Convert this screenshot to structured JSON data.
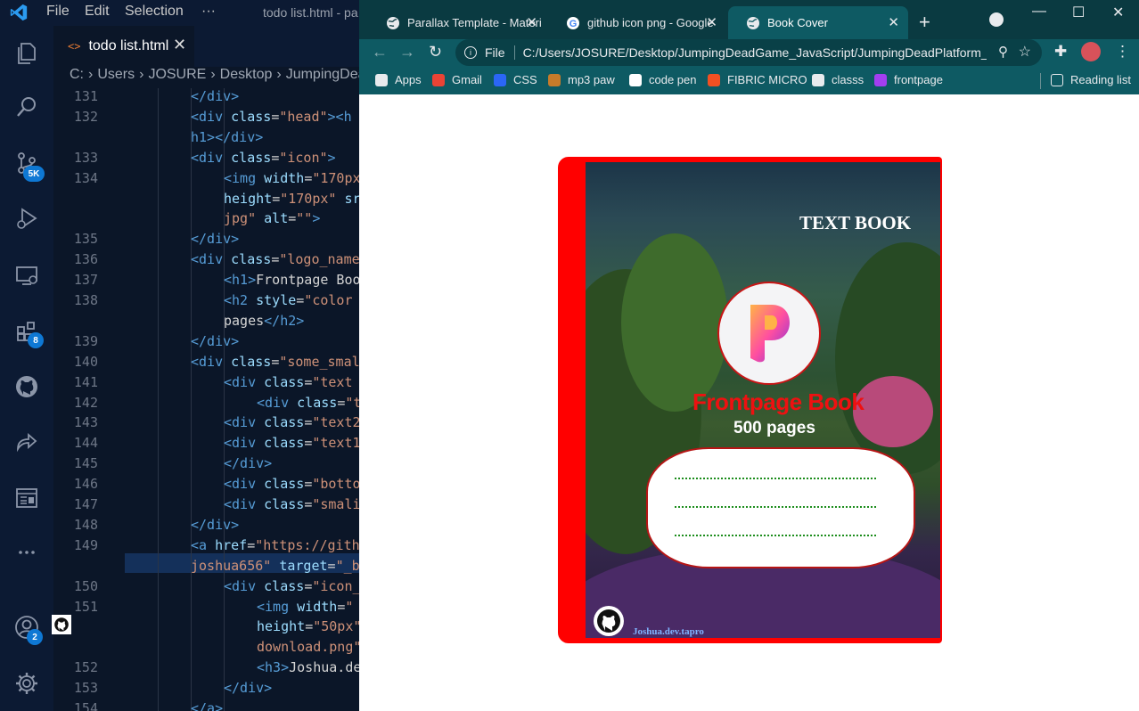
{
  "vscode": {
    "menu": [
      "File",
      "Edit",
      "Selection",
      "···"
    ],
    "window_title": "todo list.html - pa",
    "activity_badges": {
      "source_control": "5K",
      "extensions": "8",
      "accounts": "2"
    },
    "tab": {
      "icon": "<>",
      "label": "todo list.html",
      "close": "✕"
    },
    "breadcrumb": [
      "C:",
      "›",
      "Users",
      "›",
      "JOSURE",
      "›",
      "Desktop",
      "›",
      "JumpingDeadG"
    ],
    "line_numbers": [
      "131",
      "132",
      "133",
      "134",
      "135",
      "136",
      "137",
      "138",
      "139",
      "140",
      "141",
      "142",
      "143",
      "144",
      "145",
      "146",
      "147",
      "148",
      "149",
      "150",
      "151",
      "152",
      "153",
      "154"
    ],
    "code": [
      {
        "indent": 0,
        "parts": [
          [
            "tg",
            "</div>"
          ]
        ]
      },
      {
        "indent": 0,
        "parts": [
          [
            "tg",
            "<div "
          ],
          [
            "at",
            "class"
          ],
          [
            "tx",
            "="
          ],
          [
            "st",
            "\"head\""
          ],
          [
            "tg",
            "><h"
          ]
        ]
      },
      {
        "indent": 0,
        "parts": [
          [
            "tg",
            "h1></div>"
          ]
        ]
      },
      {
        "indent": 0,
        "parts": [
          [
            "tg",
            "<div "
          ],
          [
            "at",
            "class"
          ],
          [
            "tx",
            "="
          ],
          [
            "st",
            "\"icon\""
          ],
          [
            "tg",
            ">"
          ]
        ]
      },
      {
        "indent": 1,
        "parts": [
          [
            "tg",
            "<img "
          ],
          [
            "at",
            "width"
          ],
          [
            "tx",
            "="
          ],
          [
            "st",
            "\"170px"
          ]
        ]
      },
      {
        "indent": 1,
        "parts": [
          [
            "at",
            "height"
          ],
          [
            "tx",
            "="
          ],
          [
            "st",
            "\"170px\" "
          ],
          [
            "at",
            "sr"
          ]
        ]
      },
      {
        "indent": 1,
        "parts": [
          [
            "st",
            "jpg\" "
          ],
          [
            "at",
            "alt"
          ],
          [
            "tx",
            "="
          ],
          [
            "st",
            "\"\""
          ],
          [
            "tg",
            ">"
          ]
        ]
      },
      {
        "indent": 0,
        "parts": [
          [
            "tg",
            "</div>"
          ]
        ]
      },
      {
        "indent": 0,
        "parts": [
          [
            "tg",
            "<div "
          ],
          [
            "at",
            "class"
          ],
          [
            "tx",
            "="
          ],
          [
            "st",
            "\"logo_name"
          ]
        ]
      },
      {
        "indent": 1,
        "parts": [
          [
            "tg",
            "<h1>"
          ],
          [
            "tx",
            "Frontpage Boo"
          ]
        ]
      },
      {
        "indent": 1,
        "parts": [
          [
            "tg",
            "<h2 "
          ],
          [
            "at",
            "style"
          ],
          [
            "tx",
            "="
          ],
          [
            "st",
            "\"color"
          ]
        ]
      },
      {
        "indent": 1,
        "parts": [
          [
            "tx",
            "pages"
          ],
          [
            "tg",
            "</h2>"
          ]
        ]
      },
      {
        "indent": 0,
        "parts": [
          [
            "tg",
            "</div>"
          ]
        ]
      },
      {
        "indent": 0,
        "parts": [
          [
            "tg",
            "<div "
          ],
          [
            "at",
            "class"
          ],
          [
            "tx",
            "="
          ],
          [
            "st",
            "\"some_smal"
          ]
        ]
      },
      {
        "indent": 1,
        "parts": [
          [
            "tg",
            "<div "
          ],
          [
            "at",
            "class"
          ],
          [
            "tx",
            "="
          ],
          [
            "st",
            "\"text"
          ]
        ]
      },
      {
        "indent": 2,
        "parts": [
          [
            "tg",
            "<div "
          ],
          [
            "at",
            "class"
          ],
          [
            "tx",
            "="
          ],
          [
            "st",
            "\"t"
          ]
        ]
      },
      {
        "indent": 1,
        "parts": [
          [
            "tg",
            "<div "
          ],
          [
            "at",
            "class"
          ],
          [
            "tx",
            "="
          ],
          [
            "st",
            "\"text2"
          ]
        ]
      },
      {
        "indent": 1,
        "parts": [
          [
            "tg",
            "<div "
          ],
          [
            "at",
            "class"
          ],
          [
            "tx",
            "="
          ],
          [
            "st",
            "\"text1"
          ]
        ]
      },
      {
        "indent": 1,
        "parts": [
          [
            "tg",
            "</div>"
          ]
        ]
      },
      {
        "indent": 1,
        "parts": [
          [
            "tg",
            "<div "
          ],
          [
            "at",
            "class"
          ],
          [
            "tx",
            "="
          ],
          [
            "st",
            "\"botto"
          ]
        ]
      },
      {
        "indent": 1,
        "parts": [
          [
            "tg",
            "<div "
          ],
          [
            "at",
            "class"
          ],
          [
            "tx",
            "="
          ],
          [
            "st",
            "\"smali"
          ]
        ]
      },
      {
        "indent": 0,
        "parts": [
          [
            "tg",
            "</div>"
          ]
        ]
      },
      {
        "indent": 0,
        "parts": [
          [
            "tg",
            "<a "
          ],
          [
            "at",
            "href"
          ],
          [
            "tx",
            "="
          ],
          [
            "st",
            "\"https://gith"
          ]
        ]
      },
      {
        "indent": 0,
        "parts": [
          [
            "st",
            "joshua656\" "
          ],
          [
            "at",
            "target"
          ],
          [
            "tx",
            "="
          ],
          [
            "st",
            "\"_b"
          ]
        ]
      },
      {
        "indent": 1,
        "parts": [
          [
            "tg",
            "<div "
          ],
          [
            "at",
            "class"
          ],
          [
            "tx",
            "="
          ],
          [
            "st",
            "\"icon_"
          ]
        ]
      },
      {
        "indent": 2,
        "parts": [
          [
            "tg",
            "<img "
          ],
          [
            "at",
            "width"
          ],
          [
            "tx",
            "="
          ],
          [
            "st",
            "\""
          ]
        ]
      },
      {
        "indent": 2,
        "parts": [
          [
            "at",
            "height"
          ],
          [
            "tx",
            "="
          ],
          [
            "st",
            "\"50px\""
          ]
        ]
      },
      {
        "indent": 2,
        "parts": [
          [
            "st",
            "download.png\""
          ]
        ]
      },
      {
        "indent": 2,
        "parts": [
          [
            "tg",
            "<h3>"
          ],
          [
            "tx",
            "Joshua.de"
          ]
        ]
      },
      {
        "indent": 1,
        "parts": [
          [
            "tg",
            "</div>"
          ]
        ]
      },
      {
        "indent": 0,
        "parts": [
          [
            "tg",
            "</a>"
          ]
        ]
      }
    ]
  },
  "chrome": {
    "tabs": [
      {
        "title": "Parallax Template - Materi",
        "icon": "globe-icon"
      },
      {
        "title": "github icon png - Google",
        "icon": "google-icon"
      },
      {
        "title": "Book Cover",
        "icon": "globe-icon",
        "active": true
      }
    ],
    "omnibox": {
      "scheme": "File",
      "url": "C:/Users/JOSURE/Desktop/JumpingDeadGame_JavaScript/JumpingDeadPlatform_..."
    },
    "bookmarks": [
      {
        "label": "Apps",
        "icon": "apps-grid-icon",
        "color": "#e8eaed"
      },
      {
        "label": "Gmail",
        "icon": "gmail-icon",
        "color": "#ea4335"
      },
      {
        "label": "CSS",
        "icon": "css-icon",
        "color": "#2b66f6"
      },
      {
        "label": "mp3 paw",
        "icon": "paw-icon",
        "color": "#c77b2a"
      },
      {
        "label": "code pen",
        "icon": "codepen-icon",
        "color": "#ffffff"
      },
      {
        "label": "FIBRIC MICRO",
        "icon": "microsoft-icon",
        "color": "#f25022"
      },
      {
        "label": "classs",
        "icon": "globe-icon",
        "color": "#e8eaed"
      },
      {
        "label": "frontpage",
        "icon": "frontpage-icon",
        "color": "#a33ef0"
      }
    ],
    "reading_list": "Reading list"
  },
  "book": {
    "header": "TEXT BOOK",
    "name": "Frontpage Book",
    "pages": "500 pages",
    "author": "Joshua.dev.tapro",
    "colors": {
      "spine": "#ff0000",
      "name": "#ee1111",
      "dots": "#1c8d1c"
    }
  }
}
